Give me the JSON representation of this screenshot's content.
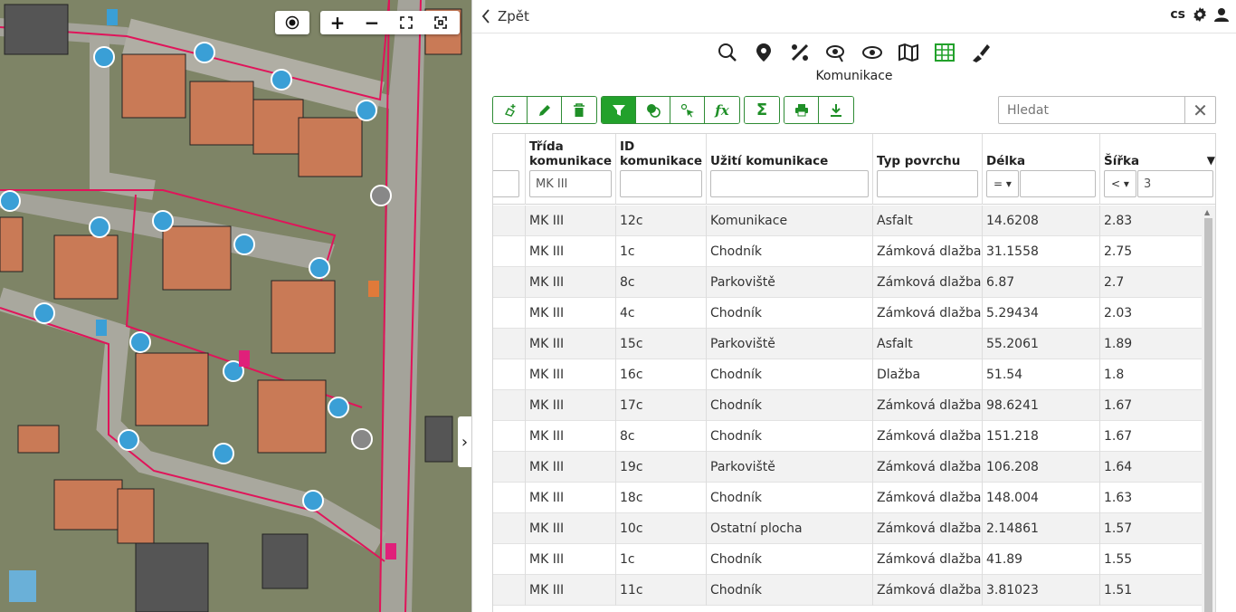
{
  "map": {
    "controls": [
      "locate",
      "zoom-in",
      "zoom-out",
      "fullscreen",
      "zoom-extent"
    ]
  },
  "topbar": {
    "back_label": "Zpět",
    "language": "cs"
  },
  "section_title": "Komunikace",
  "search": {
    "placeholder": "Hledat"
  },
  "table": {
    "columns": [
      {
        "label": ""
      },
      {
        "label": "Třída\nkomunikace"
      },
      {
        "label": "ID\nkomunikace"
      },
      {
        "label": "Užití komunikace"
      },
      {
        "label": "Typ povrchu"
      },
      {
        "label": "Délka"
      },
      {
        "label": "Šířka"
      }
    ],
    "filters": {
      "trida": "MK III",
      "delka_op": "=",
      "sirka_op": "<",
      "sirka_val": "3"
    },
    "rows": [
      [
        "MK III",
        "12c",
        "Komunikace",
        "Asfalt",
        "14.6208",
        "2.83"
      ],
      [
        "MK III",
        "1c",
        "Chodník",
        "Zámková dlažba",
        "31.1558",
        "2.75"
      ],
      [
        "MK III",
        "8c",
        "Parkoviště",
        "Zámková dlažba",
        "6.87",
        "2.7"
      ],
      [
        "MK III",
        "4c",
        "Chodník",
        "Zámková dlažba",
        "5.29434",
        "2.03"
      ],
      [
        "MK III",
        "15c",
        "Parkoviště",
        "Asfalt",
        "55.2061",
        "1.89"
      ],
      [
        "MK III",
        "16c",
        "Chodník",
        "Dlažba",
        "51.54",
        "1.8"
      ],
      [
        "MK III",
        "17c",
        "Chodník",
        "Zámková dlažba",
        "98.6241",
        "1.67"
      ],
      [
        "MK III",
        "8c",
        "Chodník",
        "Zámková dlažba",
        "151.218",
        "1.67"
      ],
      [
        "MK III",
        "19c",
        "Parkoviště",
        "Zámková dlažba",
        "106.208",
        "1.64"
      ],
      [
        "MK III",
        "18c",
        "Chodník",
        "Zámková dlažba",
        "148.004",
        "1.63"
      ],
      [
        "MK III",
        "10c",
        "Ostatní plocha",
        "Zámková dlažba",
        "2.14861",
        "1.57"
      ],
      [
        "MK III",
        "1c",
        "Chodník",
        "Zámková dlažba",
        "41.89",
        "1.55"
      ],
      [
        "MK III",
        "11c",
        "Chodník",
        "Zámková dlažba",
        "3.81023",
        "1.51"
      ]
    ]
  },
  "colors": {
    "accent": "#22a12b",
    "road_line": "#e0145a"
  }
}
